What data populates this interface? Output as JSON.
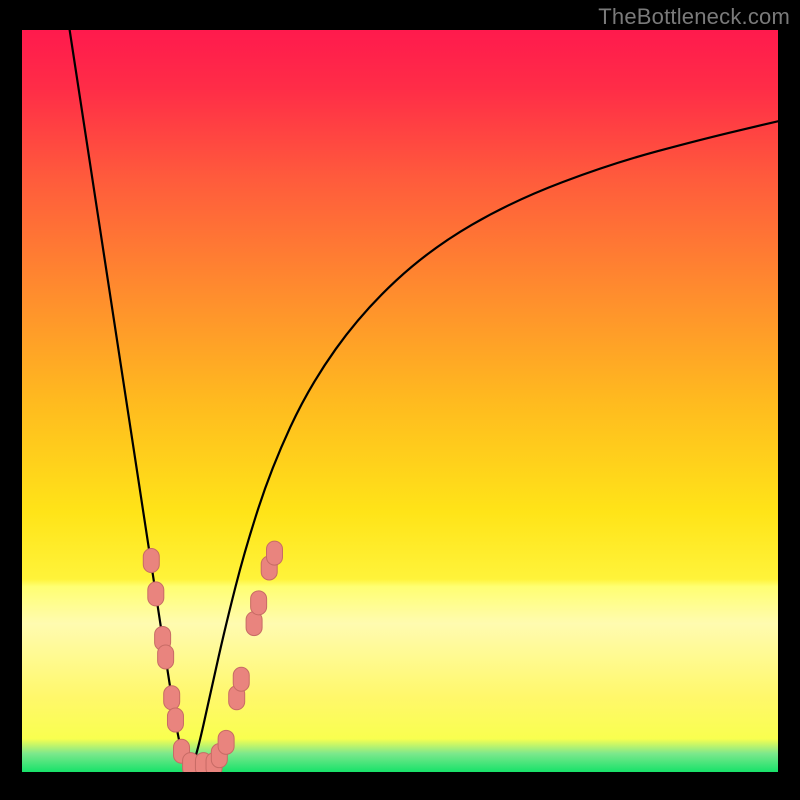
{
  "watermark": "TheBottleneck.com",
  "colors": {
    "bg": "#000000",
    "curve": "#000000",
    "marker_fill": "#e9847e",
    "marker_stroke": "#c76b65",
    "gradient_stops": [
      {
        "offset": 0.0,
        "color": "#ff1a4d"
      },
      {
        "offset": 0.08,
        "color": "#ff2d47"
      },
      {
        "offset": 0.2,
        "color": "#ff5b3c"
      },
      {
        "offset": 0.35,
        "color": "#ff8b2e"
      },
      {
        "offset": 0.5,
        "color": "#ffba1f"
      },
      {
        "offset": 0.65,
        "color": "#ffe418"
      },
      {
        "offset": 0.74,
        "color": "#fff33a"
      },
      {
        "offset": 0.75,
        "color": "#ffff72"
      },
      {
        "offset": 0.8,
        "color": "#fffbb0"
      },
      {
        "offset": 0.9,
        "color": "#fff86a"
      },
      {
        "offset": 0.955,
        "color": "#f9ff4f"
      },
      {
        "offset": 0.975,
        "color": "#7de88c"
      },
      {
        "offset": 1.0,
        "color": "#17e26a"
      }
    ]
  },
  "chart_data": {
    "type": "line",
    "title": "",
    "xlabel": "",
    "ylabel": "",
    "xlim": [
      0,
      100
    ],
    "ylim": [
      0,
      100
    ],
    "series": [
      {
        "name": "left-branch",
        "x": [
          6.3,
          7.8,
          9.3,
          10.8,
          12.3,
          13.8,
          15.3,
          16.8,
          18.3,
          19.8,
          20.6,
          21.3,
          22.0
        ],
        "y": [
          100,
          90.0,
          80.0,
          70.0,
          60.0,
          50.0,
          40.0,
          30.0,
          20.0,
          10.0,
          5.0,
          2.0,
          0.5
        ]
      },
      {
        "name": "right-branch",
        "x": [
          22.5,
          23.5,
          25.0,
          27.0,
          29.5,
          33.0,
          38.0,
          45.0,
          54.0,
          65.0,
          78.0,
          90.0,
          100.0
        ],
        "y": [
          0.5,
          4.0,
          11.0,
          20.0,
          30.0,
          41.0,
          52.0,
          62.0,
          70.5,
          77.0,
          82.0,
          85.3,
          87.7
        ]
      }
    ],
    "markers": {
      "name": "data-points",
      "points": [
        {
          "x": 17.1,
          "y": 28.5
        },
        {
          "x": 17.7,
          "y": 24.0
        },
        {
          "x": 18.6,
          "y": 18.0
        },
        {
          "x": 19.0,
          "y": 15.5
        },
        {
          "x": 19.8,
          "y": 10.0
        },
        {
          "x": 20.3,
          "y": 7.0
        },
        {
          "x": 21.1,
          "y": 2.8
        },
        {
          "x": 22.3,
          "y": 1.0
        },
        {
          "x": 24.0,
          "y": 1.0
        },
        {
          "x": 25.4,
          "y": 1.0
        },
        {
          "x": 26.1,
          "y": 2.2
        },
        {
          "x": 27.0,
          "y": 4.0
        },
        {
          "x": 28.4,
          "y": 10.0
        },
        {
          "x": 29.0,
          "y": 12.5
        },
        {
          "x": 30.7,
          "y": 20.0
        },
        {
          "x": 31.3,
          "y": 22.8
        },
        {
          "x": 32.7,
          "y": 27.5
        },
        {
          "x": 33.4,
          "y": 29.5
        }
      ]
    }
  }
}
